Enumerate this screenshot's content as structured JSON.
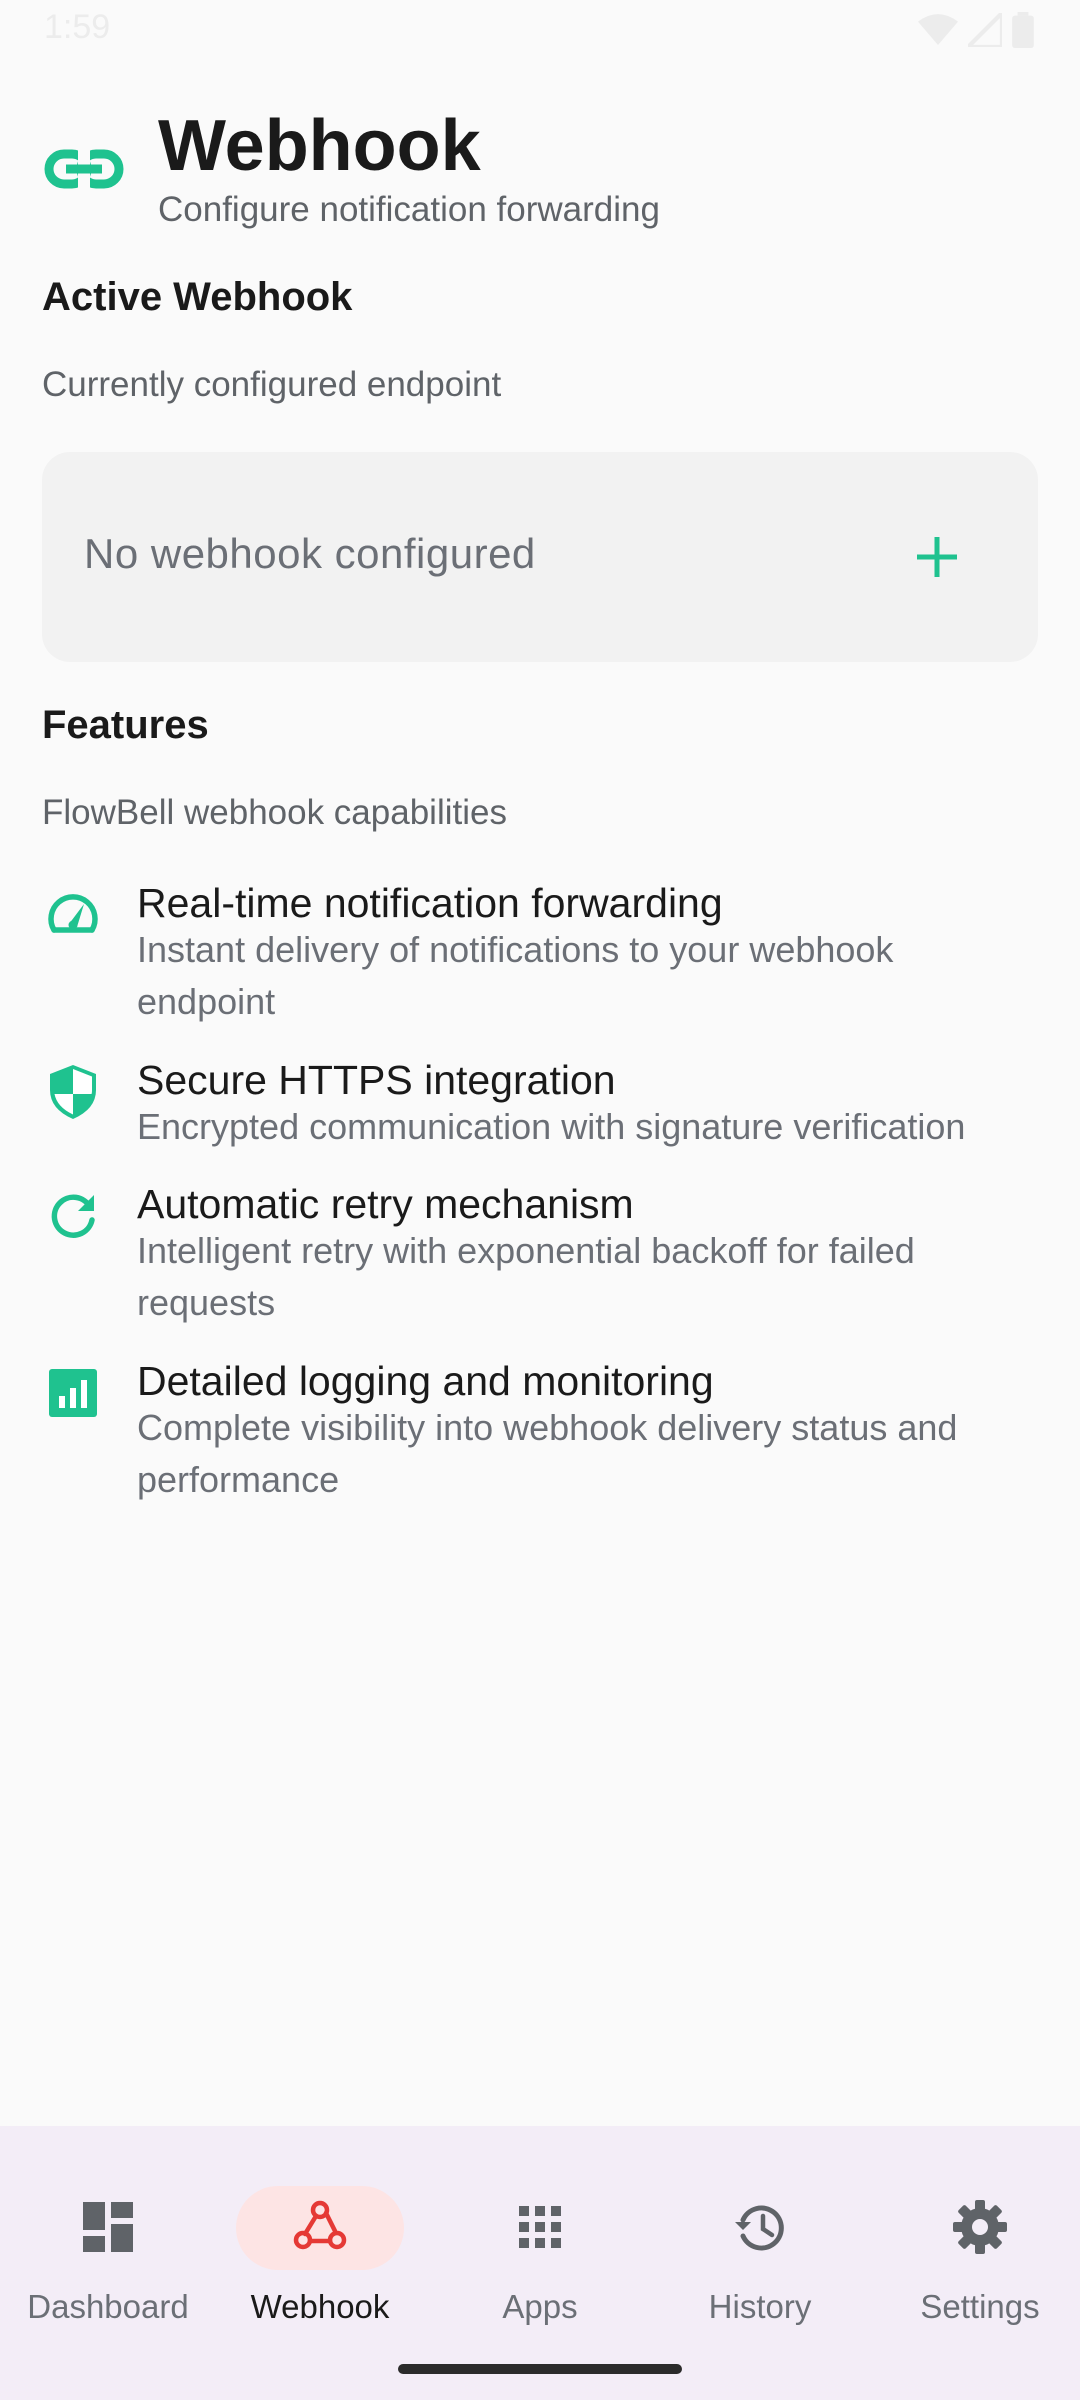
{
  "status_bar": {
    "time": "1:59",
    "icons": [
      "wifi-icon",
      "signal-icon",
      "battery-icon"
    ]
  },
  "header": {
    "icon": "link-icon",
    "title": "Webhook",
    "subtitle": "Configure notification forwarding"
  },
  "active_webhook": {
    "title": "Active Webhook",
    "description": "Currently configured endpoint",
    "empty_text": "No webhook configured",
    "add_icon": "plus-icon"
  },
  "features": {
    "title": "Features",
    "description": "FlowBell webhook capabilities",
    "items": [
      {
        "icon": "speedometer-icon",
        "title": "Real-time notification forwarding",
        "description": "Instant delivery of notifications to your webhook endpoint"
      },
      {
        "icon": "shield-icon",
        "title": "Secure HTTPS integration",
        "description": "Encrypted communication with signature verification"
      },
      {
        "icon": "refresh-icon",
        "title": "Automatic retry mechanism",
        "description": "Intelligent retry with exponential backoff for failed requests"
      },
      {
        "icon": "analytics-icon",
        "title": "Detailed logging and monitoring",
        "description": "Complete visibility into webhook delivery status and performance"
      }
    ]
  },
  "bottom_nav": {
    "items": [
      {
        "label": "Dashboard",
        "icon": "dashboard-icon",
        "active": false
      },
      {
        "label": "Webhook",
        "icon": "webhook-icon",
        "active": true
      },
      {
        "label": "Apps",
        "icon": "apps-grid-icon",
        "active": false
      },
      {
        "label": "History",
        "icon": "history-icon",
        "active": false
      },
      {
        "label": "Settings",
        "icon": "gear-icon",
        "active": false
      }
    ]
  },
  "colors": {
    "accent": "#1fc28f",
    "active_nav": "#e53935",
    "nav_background": "#f3edf7",
    "active_pill": "#fde4e4"
  }
}
